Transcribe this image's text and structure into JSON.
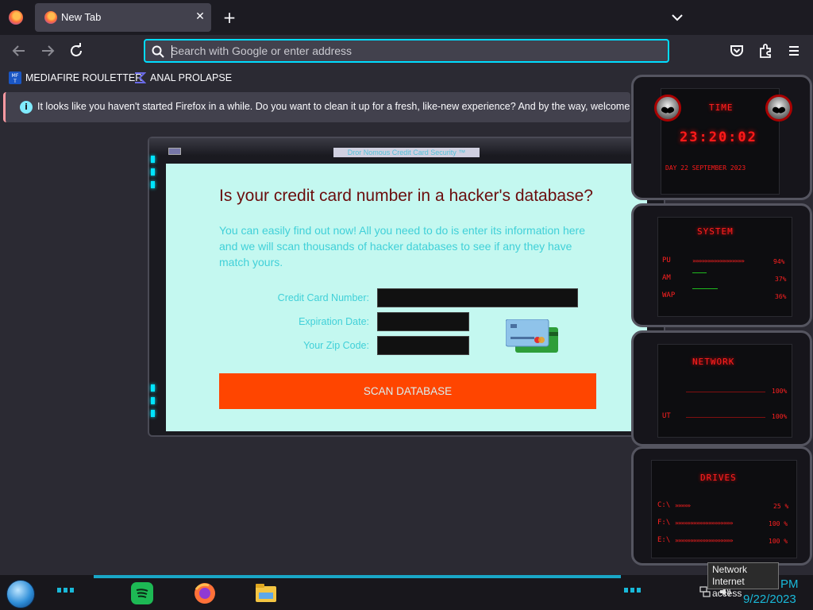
{
  "browser": {
    "tab": {
      "title": "New Tab"
    },
    "new_tab_symbol": "+",
    "close_symbol": "✕",
    "urlbar": {
      "placeholder": "Search with Google or enter address",
      "value": ""
    },
    "bookmarks": [
      {
        "label": "MEDIAFIRE ROULETTER",
        "icon": "mediafire-icon"
      },
      {
        "label": "ANAL PROLAPSE",
        "icon": "bookmark-logo-icon"
      }
    ],
    "infobar": {
      "icon_glyph": "i",
      "text": "It looks like you haven't started Firefox in a while. Do you want to clean it up for a fresh, like-new experience? And by the way, welcome back!"
    }
  },
  "scam_window": {
    "title": "Dror Nomous Credit Card Security ™",
    "heading": "Is your credit card number in a hacker's database?",
    "intro": "You can easily find out now! All you need to do is enter its information here and we will scan thousands of hacker databases to see if any they have match yours.",
    "fields": {
      "card_number_label": "Credit Card Number:",
      "expiration_label": "Expiration Date:",
      "zip_label": "Your Zip Code:",
      "card_number_value": "",
      "expiration_value": "",
      "zip_value": ""
    },
    "scan_button": "SCAN DATABASE",
    "colors": {
      "panel_bg": "#c4f8f0",
      "heading": "#6b0d0d",
      "text": "#40d0d8",
      "button": "#ff4500"
    }
  },
  "gadget": {
    "time": {
      "title": "TIME",
      "clock": "23:20:02",
      "date": "DAY 22 SEPTEMBER 2023"
    },
    "system": {
      "title": "SYSTEM",
      "rows": [
        {
          "label": "PU",
          "value": "94%"
        },
        {
          "label": "AM",
          "value": "37%"
        },
        {
          "label": "WAP",
          "value": "36%"
        }
      ]
    },
    "network": {
      "title": "NETWORK",
      "rows": [
        {
          "label": "",
          "value": "100%"
        },
        {
          "label": "UT",
          "value": "100%"
        }
      ]
    },
    "drives": {
      "title": "DRIVES",
      "rows": [
        {
          "label": "C:\\",
          "value": "25 %"
        },
        {
          "label": "F:\\",
          "value": "100 %"
        },
        {
          "label": "E:\\",
          "value": "100 %"
        }
      ]
    },
    "colors": {
      "accent": "#ff2020"
    }
  },
  "taskbar": {
    "apps": [
      "spotify-icon",
      "firefox-icon",
      "file-explorer-icon"
    ],
    "tooltip": {
      "line1": "Network",
      "line2": "Internet access"
    },
    "clock": {
      "time": "PM",
      "date": "9/22/2023"
    },
    "accent": "#19b9d9"
  }
}
